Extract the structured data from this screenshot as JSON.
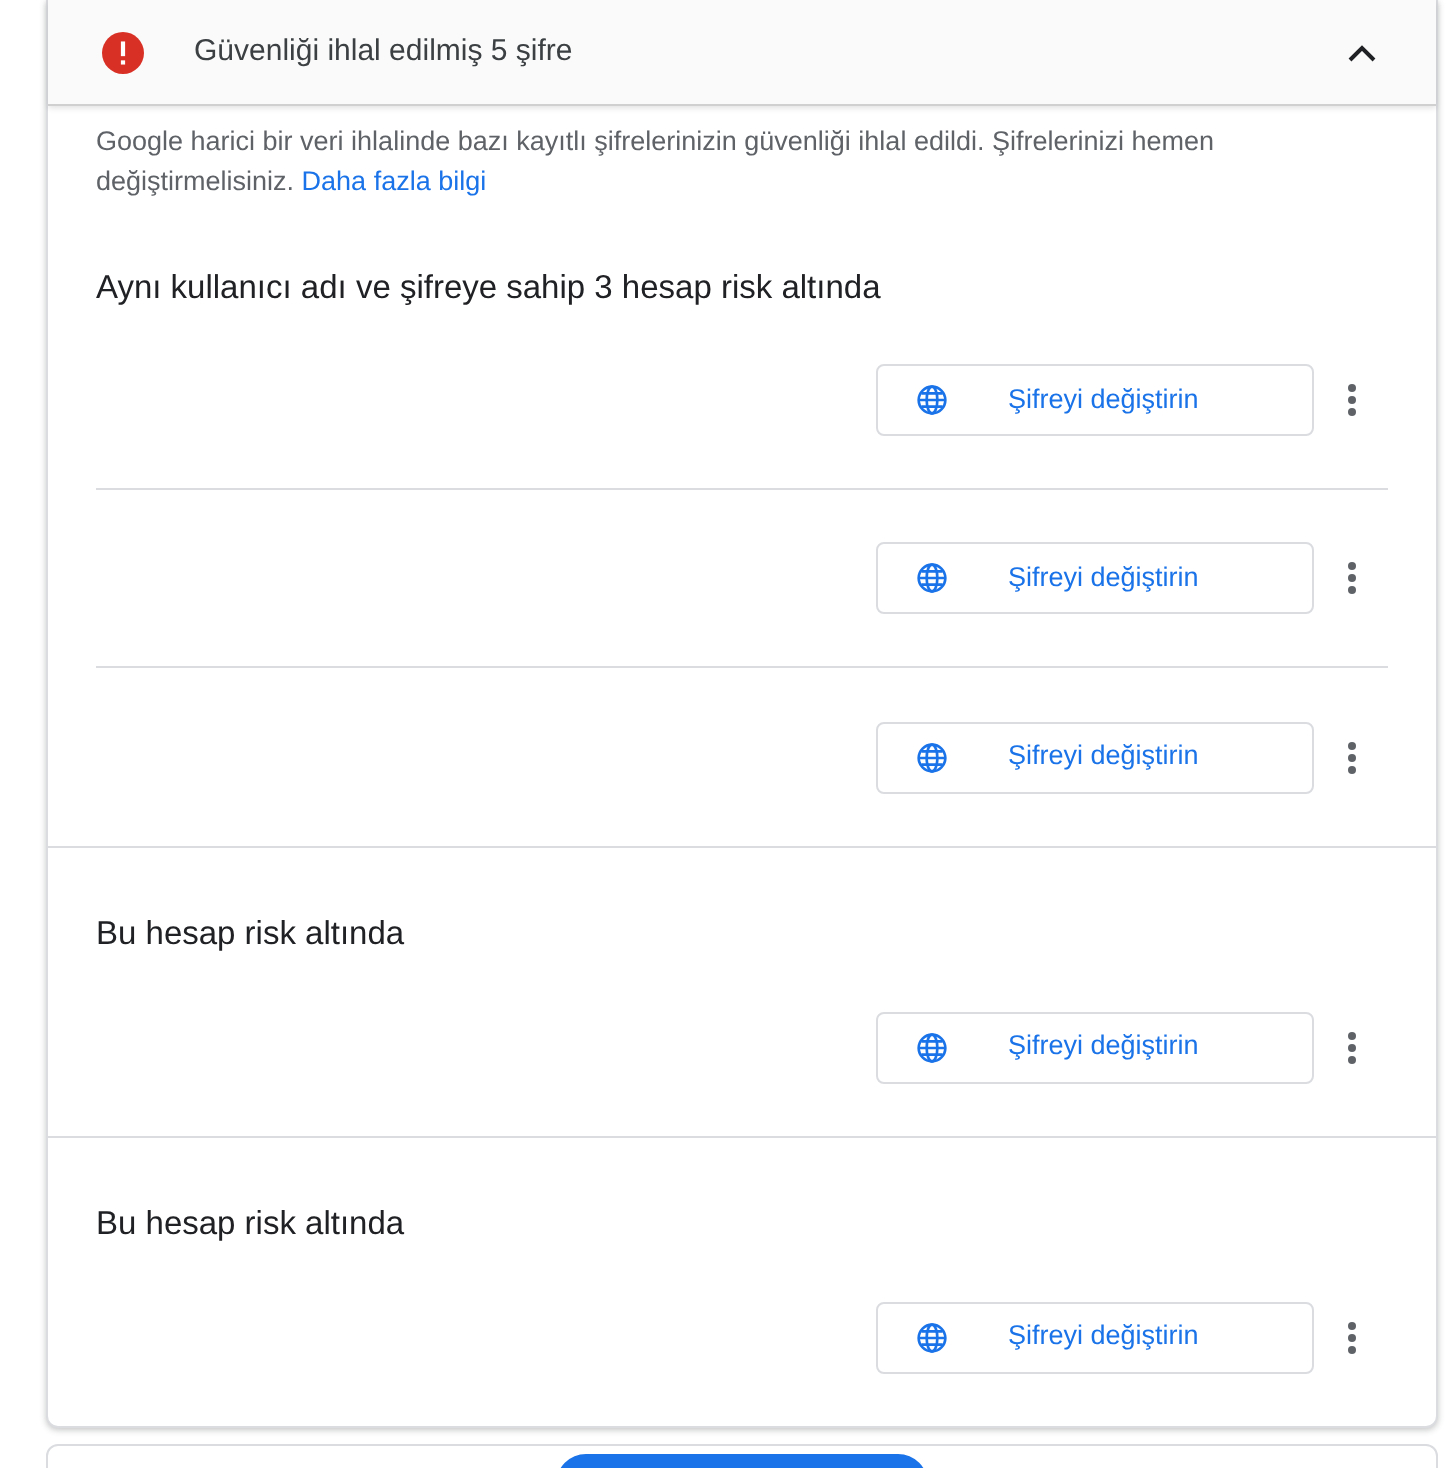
{
  "header": {
    "title": "Güvenliği ihlal edilmiş 5 şifre",
    "expanded": true
  },
  "description": {
    "text": "Google harici bir veri ihlalinde bazı kayıtlı şifrelerinizin güvenliği ihlal edildi. Şifrelerinizi hemen değiştirmelisiniz.",
    "link": "Daha fazla bilgi"
  },
  "groups": [
    {
      "title": "Aynı kullanıcı adı ve şifreye sahip 3 hesap risk altında",
      "rows": [
        {
          "button": "Şifreyi değiştirin"
        },
        {
          "button": "Şifreyi değiştirin"
        },
        {
          "button": "Şifreyi değiştirin"
        }
      ]
    },
    {
      "title": "Bu hesap risk altında",
      "rows": [
        {
          "button": "Şifreyi değiştirin"
        }
      ]
    },
    {
      "title": "Bu hesap risk altında",
      "rows": [
        {
          "button": "Şifreyi değiştirin"
        }
      ]
    }
  ]
}
